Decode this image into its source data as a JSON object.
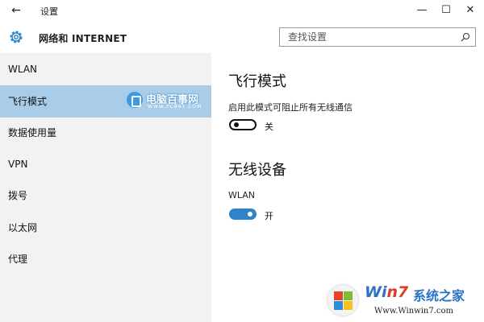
{
  "titlebar": {
    "back_glyph": "←",
    "title": "设置",
    "minimize_glyph": "—",
    "maximize_glyph": "☐",
    "close_glyph": "✕"
  },
  "header": {
    "section_title": "网络和 INTERNET",
    "search_placeholder": "查找设置"
  },
  "sidebar": {
    "items": [
      {
        "label": "WLAN",
        "active": false
      },
      {
        "label": "飞行模式",
        "active": true
      },
      {
        "label": "数据使用量",
        "active": false
      },
      {
        "label": "VPN",
        "active": false
      },
      {
        "label": "拨号",
        "active": false
      },
      {
        "label": "以太网",
        "active": false
      },
      {
        "label": "代理",
        "active": false
      }
    ]
  },
  "content": {
    "airplane": {
      "title": "飞行模式",
      "description": "启用此模式可阻止所有无线通信",
      "toggle_state": "关",
      "is_on": false
    },
    "wireless": {
      "title": "无线设备",
      "wlan_label": "WLAN",
      "toggle_state": "开",
      "is_on": true
    }
  },
  "watermarks": {
    "top_name": "电脑百事网",
    "top_url": "WWW.PC841.COM",
    "bottom_brand_prefix": "Wi",
    "bottom_brand_seven": "n7",
    "bottom_brand_cn": "系统之家",
    "bottom_url": "Www.Winwin7.com"
  },
  "colors": {
    "accent": "#2f84c9",
    "sidebar_active": "#a9cde9",
    "sidebar_bg": "#f2f2f2"
  }
}
